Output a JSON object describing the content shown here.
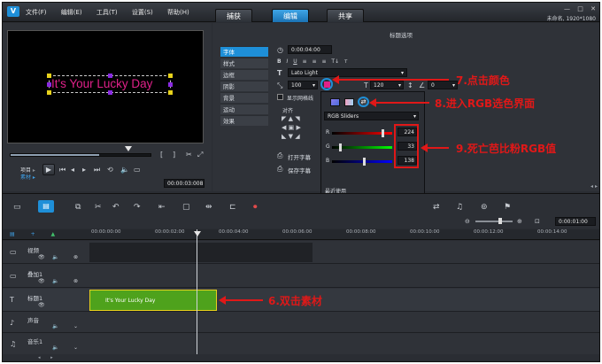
{
  "app": {
    "logo": "V",
    "project_info": "未命名, 1920*1080"
  },
  "menu": [
    "文件(F)",
    "编辑(E)",
    "工具(T)",
    "设置(S)",
    "帮助(H)"
  ],
  "tabs": [
    {
      "label": "捕获",
      "active": false
    },
    {
      "label": "编辑",
      "active": true
    },
    {
      "label": "共享",
      "active": false
    }
  ],
  "preview": {
    "title_text": "It's Your Lucky Day",
    "title_color": "#e0218a",
    "mode_project": "项目",
    "mode_clip": "素材",
    "timecode": "00:00:03:008",
    "scrub_position": 0.63
  },
  "options": {
    "header": "标题选项",
    "side_tabs": [
      "字体",
      "样式",
      "边框",
      "阴影",
      "背景",
      "运动",
      "效果"
    ],
    "duration": "0:00:04:00",
    "font_name": "Lato Light",
    "zoom": "100",
    "font_size": "120",
    "line_spacing": "100",
    "rotation": "0",
    "grid_label": "显示网格线",
    "align_label": "对齐",
    "open_title": "打开字幕",
    "save_title": "保存字幕"
  },
  "color_picker": {
    "mode": "RGB Sliders",
    "r_label": "R",
    "g_label": "G",
    "b_label": "B",
    "r": "224",
    "g": "33",
    "b": "138",
    "recent_label": "最近使用",
    "recent_colors": [
      "#e0218a",
      "#f4d0e0",
      "#c8c8c8",
      "#b4b4b4",
      "#9c9c9c",
      "#888888",
      "#747474",
      "#606060",
      "#4c4c4c",
      "#383838",
      "#2a2a2a",
      "#1c1c1c",
      "#101010"
    ]
  },
  "timeline": {
    "ruler_marks": [
      "00:00:00:00",
      "00:00:02:00",
      "00:00:04:00",
      "00:00:06:00",
      "00:00:08:00",
      "00:00:10:00",
      "00:00:12:00",
      "00:00:14:00"
    ],
    "zoom_time": "0:00:01:00",
    "tracks": [
      {
        "label": "视频"
      },
      {
        "label": "叠加1"
      },
      {
        "label": "标题1"
      },
      {
        "label": "声音"
      },
      {
        "label": "音乐1"
      }
    ],
    "clip_text": "It's Your Lucky Day",
    "clip_color": "#4ea21c"
  },
  "annotations": {
    "step6": "6.双击素材",
    "step7": "7.点击颜色",
    "step8": "8.进入RGB选色界面",
    "step9": "9.死亡芭比粉RGB值"
  },
  "colors": {
    "accent_blue": "#1e8fd8",
    "annotation_red": "#e01818",
    "selected_pink": "#e0218a"
  }
}
